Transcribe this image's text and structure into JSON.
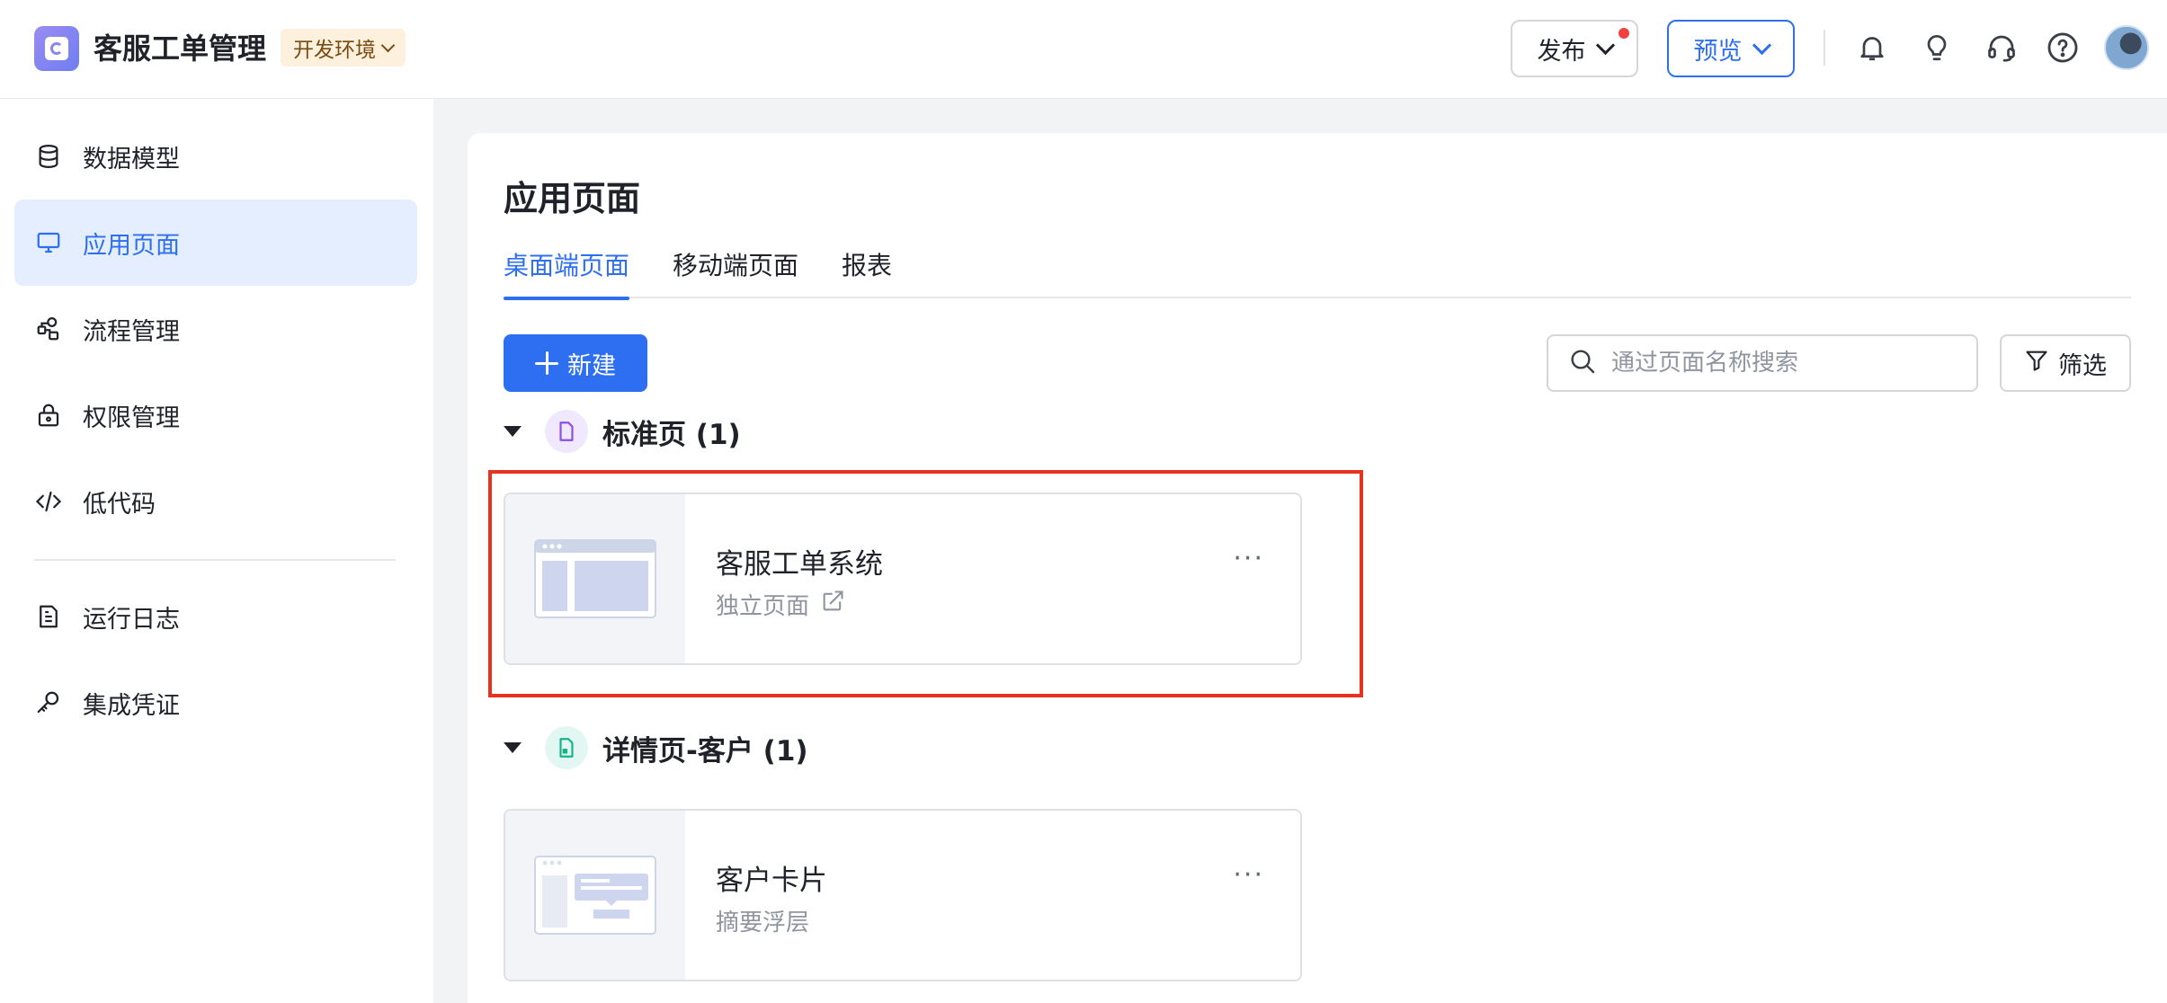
{
  "header": {
    "app_title": "客服工单管理",
    "env_label": "开发环境",
    "publish_label": "发布",
    "preview_label": "预览",
    "icons": [
      "bell-icon",
      "lightbulb-icon",
      "headset-icon",
      "help-icon"
    ]
  },
  "sidebar": {
    "items": [
      {
        "label": "数据模型",
        "icon": "database-icon"
      },
      {
        "label": "应用页面",
        "icon": "monitor-icon",
        "active": true
      },
      {
        "label": "流程管理",
        "icon": "flow-icon"
      },
      {
        "label": "权限管理",
        "icon": "lock-icon"
      },
      {
        "label": "低代码",
        "icon": "code-icon"
      },
      {
        "label": "运行日志",
        "icon": "log-file-icon"
      },
      {
        "label": "集成凭证",
        "icon": "key-icon"
      }
    ]
  },
  "main": {
    "title": "应用页面",
    "tabs": [
      {
        "label": "桌面端页面",
        "active": true
      },
      {
        "label": "移动端页面"
      },
      {
        "label": "报表"
      }
    ],
    "new_button": "新建",
    "search_placeholder": "通过页面名称搜索",
    "filter_button": "筛选",
    "groups": [
      {
        "title": "标准页 (1)",
        "pages": [
          {
            "name": "客服工单系统",
            "subtitle": "独立页面"
          }
        ]
      },
      {
        "title": "详情页-客户 (1)",
        "pages": [
          {
            "name": "客户卡片",
            "subtitle": "摘要浮层"
          }
        ]
      }
    ]
  },
  "colors": {
    "accent": "#2d6ff0",
    "active_nav_bg": "#e4eefe",
    "highlight_border": "#e8321d",
    "env_badge_bg": "#fdf0dc"
  }
}
